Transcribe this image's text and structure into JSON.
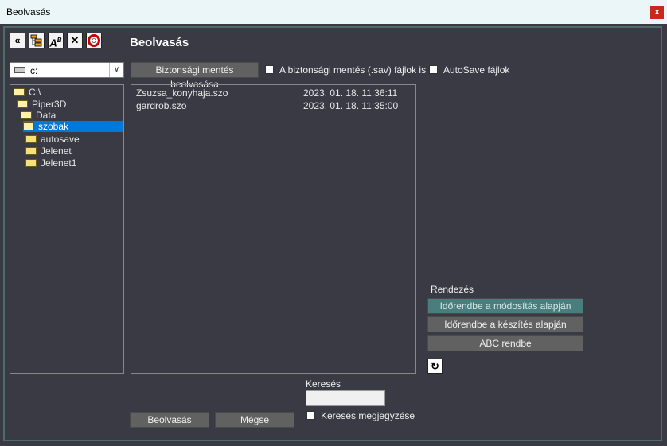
{
  "window": {
    "title": "Beolvasás",
    "close_label": "x"
  },
  "toolbar": {
    "icons": [
      "double-chevron-left-icon",
      "tree-icon",
      "spellcheck-icon",
      "close-x-icon",
      "lifebuoy-icon"
    ]
  },
  "heading": "Beolvasás",
  "drive": {
    "value": "c:"
  },
  "tree": {
    "nodes": [
      {
        "label": "C:\\",
        "level": 0,
        "open": true
      },
      {
        "label": "Piper3D",
        "level": 1,
        "open": true
      },
      {
        "label": "Data",
        "level": 2,
        "open": true
      },
      {
        "label": "szobak",
        "level": 3,
        "open": true,
        "selected": true
      },
      {
        "label": "autosave",
        "level": 4
      },
      {
        "label": "Jelenet",
        "level": 4
      },
      {
        "label": "Jelenet1",
        "level": 4
      }
    ]
  },
  "backup_button": "Biztonsági mentés beolvasása",
  "sav_checkbox": {
    "label": "A biztonsági mentés (.sav) fájlok is",
    "checked": false
  },
  "autosave_checkbox": {
    "label": "AutoSave fájlok",
    "checked": false
  },
  "files": [
    {
      "name": "Zsuzsa_konyhaja.szo",
      "date": "2023. 01. 18. 11:36:11"
    },
    {
      "name": "gardrob.szo",
      "date": "2023. 01. 18. 11:35:00"
    }
  ],
  "sort": {
    "label": "Rendezés",
    "by_modified": "Időrendbe a módosítás alapján",
    "by_created": "Időrendbe a készítés alapján",
    "abc": "ABC rendbe"
  },
  "search": {
    "label": "Keresés",
    "value": "",
    "remember_label": "Keresés megjegyzése",
    "remember_checked": false
  },
  "buttons": {
    "load": "Beolvasás",
    "cancel": "Mégse"
  },
  "colors": {
    "background": "#3a3a44",
    "accent": "#4a7d7d",
    "selection": "#0078d7"
  }
}
